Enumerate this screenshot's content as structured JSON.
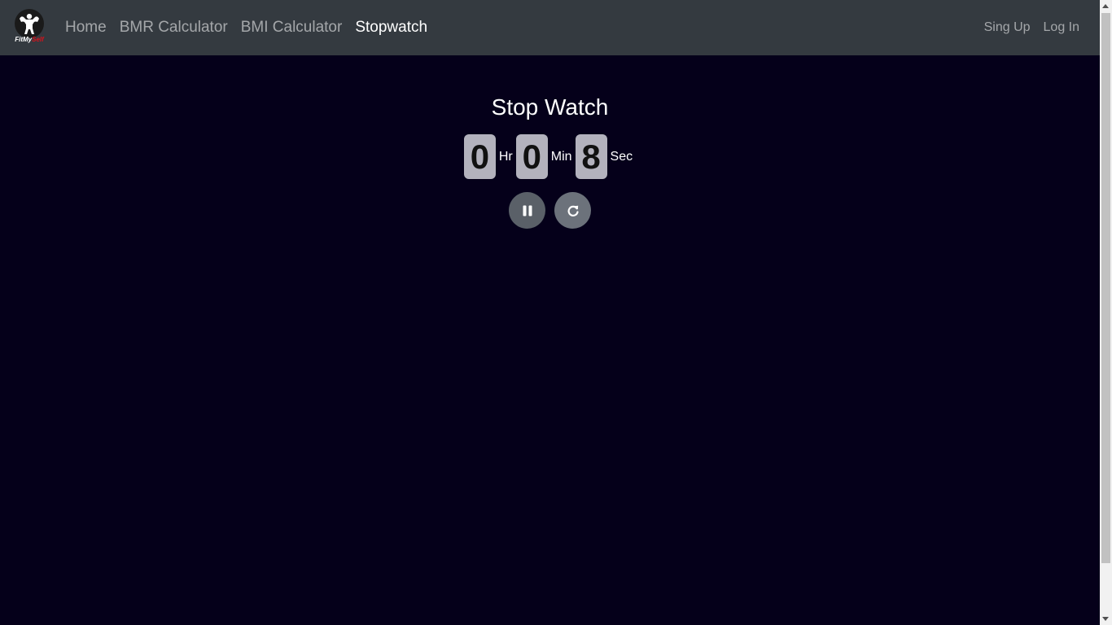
{
  "navbar": {
    "brand": {
      "name_part1": "FitMy",
      "name_part2": "Self",
      "accent_color": "#d8121b"
    },
    "links": [
      {
        "label": "Home",
        "active": false
      },
      {
        "label": "BMR Calculator",
        "active": false
      },
      {
        "label": "BMI Calculator",
        "active": false
      },
      {
        "label": "Stopwatch",
        "active": true
      }
    ],
    "auth": {
      "signup_label": "Sing Up",
      "login_label": "Log In"
    }
  },
  "stopwatch": {
    "title": "Stop Watch",
    "hours": "0",
    "hours_unit": "Hr",
    "minutes": "0",
    "minutes_unit": "Min",
    "seconds": "8",
    "seconds_unit": "Sec",
    "pause_icon": "pause-icon",
    "reset_icon": "redo-icon"
  },
  "colors": {
    "background": "#05001a",
    "navbar": "#343a40",
    "digit_box": "#b3b2bd"
  }
}
